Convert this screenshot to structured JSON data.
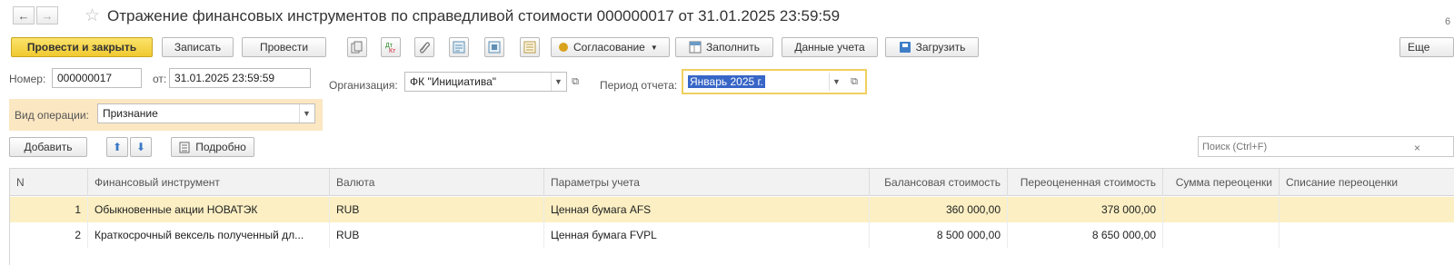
{
  "window": {
    "title": "Отражение финансовых инструментов по справедливой стоимости 000000017 от 31.01.2025 23:59:59",
    "back_glyph": "←",
    "forward_glyph": "→",
    "star_glyph": "☆",
    "right_edge_glyph": "6"
  },
  "toolbar": {
    "post_close": "Провести и закрыть",
    "save": "Записать",
    "post": "Провести",
    "approval": "Согласование",
    "fill": "Заполнить",
    "accounting_data": "Данные учета",
    "load": "Загрузить",
    "more": "Еще"
  },
  "header": {
    "number_label": "Номер:",
    "number_value": "000000017",
    "date_label": "от:",
    "date_value": "31.01.2025 23:59:59",
    "org_label": "Организация:",
    "org_value": "ФК \"Инициатива\"",
    "period_label": "Период отчета:",
    "period_value": "Январь 2025 г.",
    "op_label": "Вид операции:",
    "op_value": "Признание"
  },
  "table_toolbar": {
    "add": "Добавить",
    "up_glyph": "⬆",
    "down_glyph": "⬇",
    "details": "Подробно",
    "search_placeholder": "Поиск (Ctrl+F)",
    "clear_glyph": "×"
  },
  "table": {
    "columns": [
      "N",
      "Финансовый инструмент",
      "Валюта",
      "Параметры учета",
      "Балансовая стоимость",
      "Переоцененная стоимость",
      "Сумма переоценки",
      "Списание переоценки"
    ],
    "rows": [
      {
        "n": "1",
        "instrument": "Обыкновенные акции НОВАТЭК",
        "currency": "RUB",
        "params": "Ценная бумага AFS",
        "book": "360 000,00",
        "revalued": "378 000,00",
        "sum": "",
        "writeoff": ""
      },
      {
        "n": "2",
        "instrument": "Краткосрочный вексель полученный дл...",
        "currency": "RUB",
        "params": "Ценная бумага FVPL",
        "book": "8 500 000,00",
        "revalued": "8 650 000,00",
        "sum": "",
        "writeoff": ""
      }
    ]
  },
  "colors": {
    "accent_yellow": "#f5d447",
    "selected_row": "#fbefc3",
    "highlight_panel": "#fbe7c2",
    "period_selection": "#3766c7"
  }
}
